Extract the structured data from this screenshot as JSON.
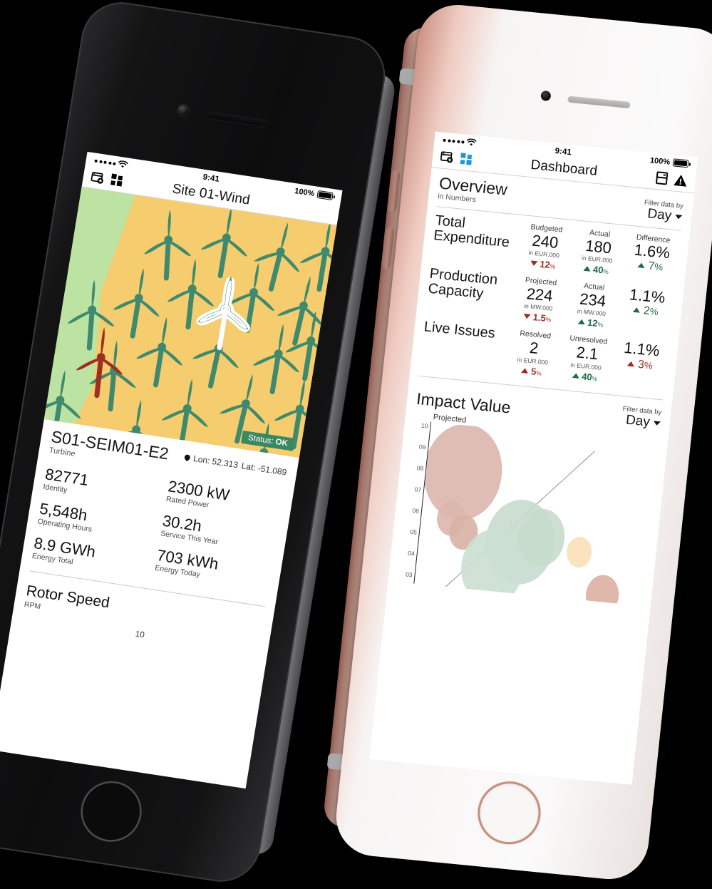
{
  "accent": {
    "green": "#3a8761",
    "red": "#9b2c22",
    "blue": "#2196d9",
    "map_yellow": "#f5cd6e",
    "map_green": "#bce3a2",
    "turbine_green": "#3f8a6e",
    "turbine_red": "#9e2e21"
  },
  "left_phone": {
    "device": "iphone-space-gray",
    "status_bar": {
      "carrier_dots": 5,
      "wifi": "wifi-icon",
      "time": "9:41",
      "battery_pct": "100%"
    },
    "toolbar": {
      "add_icon": "add-window-icon",
      "grid_icon": "grid-icon",
      "title": "Site 01-Wind",
      "right_icons": [
        "book-icon",
        "alert-icon"
      ]
    },
    "map": {
      "selected_turbine": "highlighted-white",
      "alarm_turbine": "red",
      "turbine_count": 22
    },
    "detail": {
      "status_label": "Status:",
      "status_value": "OK",
      "identifier": "S01-SEIM01-E2",
      "subtitle": "Turbine",
      "lon": "Lon: 52.313",
      "lat": "Lat: -51.089",
      "kpis_left": [
        {
          "value": "82771",
          "label": "Identity"
        },
        {
          "value": "5,548h",
          "label": "Operating Hours"
        },
        {
          "value": "8.9 GWh",
          "label": "Energy Total"
        }
      ],
      "kpis_right": [
        {
          "value": "2300 kW",
          "label": "Rated Power"
        },
        {
          "value": "30.2h",
          "label": "Service This Year"
        },
        {
          "value": "703 kWh",
          "label": "Energy Today"
        }
      ]
    },
    "rotor": {
      "title": "Rotor Speed",
      "unit": "RPM",
      "value": "10"
    }
  },
  "right_phone": {
    "device": "iphone-rose-gold",
    "status_bar": {
      "carrier_dots": 5,
      "wifi": "wifi-icon",
      "time": "9:41",
      "battery_pct": "100%"
    },
    "toolbar": {
      "add_icon": "add-window-icon",
      "grid_icon": "grid-icon",
      "title": "Dashboard",
      "right_icons": [
        "book-icon",
        "alert-icon"
      ]
    },
    "overview": {
      "title": "Overview",
      "subtitle": "in Numbers",
      "filter_label": "Filter data by",
      "filter_value": "Day",
      "rows": [
        {
          "name": "Total Expenditure",
          "c1": {
            "head": "Budgeted",
            "value": "240",
            "unit": "in EUR.000",
            "delta": "12",
            "delta_suffix": "%",
            "dir": "down",
            "color": "#9b2c22"
          },
          "c2": {
            "head": "Actual",
            "value": "180",
            "unit": "in EUR.000",
            "delta": "40",
            "delta_suffix": "%",
            "dir": "up",
            "color": "#1f6b42"
          },
          "diff": {
            "head": "Difference",
            "value": "1.6%",
            "delta": "7",
            "delta_suffix": "%",
            "dir": "up",
            "color": "#1f6b42"
          }
        },
        {
          "name": "Production Capacity",
          "c1": {
            "head": "Projected",
            "value": "224",
            "unit": "in MW.000",
            "delta": "1.5",
            "delta_suffix": "%",
            "dir": "down",
            "color": "#9b2c22"
          },
          "c2": {
            "head": "Actual",
            "value": "234",
            "unit": "in MW.000",
            "delta": "12",
            "delta_suffix": "%",
            "dir": "up",
            "color": "#1f6b42"
          },
          "diff": {
            "head": "",
            "value": "1.1%",
            "delta": "2",
            "delta_suffix": "%",
            "dir": "up",
            "color": "#1f6b42"
          }
        },
        {
          "name": "Live Issues",
          "c1": {
            "head": "Resolved",
            "value": "2",
            "unit": "in EUR.000",
            "delta": "5",
            "delta_suffix": "%",
            "dir": "up",
            "color": "#9b2c22"
          },
          "c2": {
            "head": "Unresolved",
            "value": "2.1",
            "unit": "in EUR.000",
            "delta": "40",
            "delta_suffix": "%",
            "dir": "up",
            "color": "#1f6b42"
          },
          "diff": {
            "head": "",
            "value": "1.1%",
            "delta": "3",
            "delta_suffix": "%",
            "dir": "up",
            "color": "#9b2c22"
          }
        }
      ]
    },
    "impact": {
      "title": "Impact Value",
      "filter_label": "Filter data by",
      "filter_value": "Day"
    }
  },
  "chart_data": {
    "type": "scatter",
    "title": "Impact Value",
    "series_label": "Projected",
    "ylabel": "",
    "xlabel": "",
    "yticks": [
      "10",
      "09",
      "08",
      "07",
      "06",
      "05",
      "04",
      "03"
    ],
    "ylim": [
      3,
      10
    ],
    "grid": false,
    "legend": "none",
    "trendline": true,
    "bubbles": [
      {
        "x": 0.16,
        "y": 8.0,
        "r": 0.7,
        "color": "#dcb6ac"
      },
      {
        "x": 0.13,
        "y": 5.8,
        "r": 0.26,
        "color": "#dcb6ac"
      },
      {
        "x": 0.19,
        "y": 5.2,
        "r": 0.26,
        "color": "#d8b1a6"
      },
      {
        "x": 0.44,
        "y": 5.0,
        "r": 0.62,
        "color": "#c8dccd"
      },
      {
        "x": 0.33,
        "y": 3.7,
        "r": 0.56,
        "color": "#cbdfd2"
      },
      {
        "x": 0.53,
        "y": 5.3,
        "r": 0.42,
        "color": "#c6dbcb"
      },
      {
        "x": 0.7,
        "y": 4.8,
        "r": 0.22,
        "color": "#fae0b7"
      },
      {
        "x": 0.82,
        "y": 2.9,
        "r": 0.3,
        "color": "#dcb0a2"
      }
    ]
  }
}
